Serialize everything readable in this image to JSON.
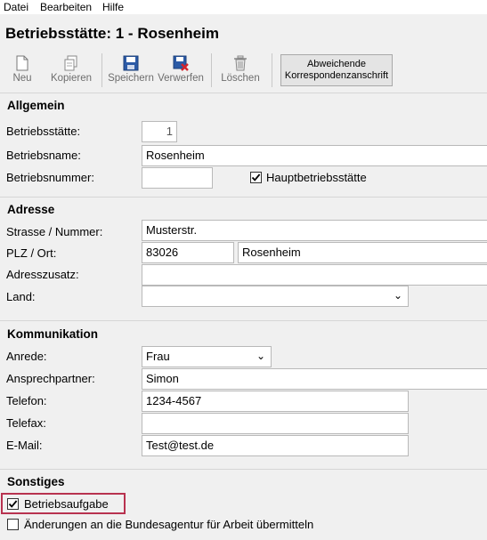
{
  "menu": {
    "file": "Datei",
    "edit": "Bearbeiten",
    "help": "Hilfe"
  },
  "page": {
    "title": "Betriebsstätte: 1 - Rosenheim"
  },
  "toolbar": {
    "new": "Neu",
    "copy": "Kopieren",
    "save": "Speichern",
    "discard": "Verwerfen",
    "delete": "Löschen",
    "alt_address_line1": "Abweichende",
    "alt_address_line2": "Korrespondenzanschrift"
  },
  "general": {
    "heading": "Allgemein",
    "site_label": "Betriebsstätte:",
    "site_value": "1",
    "name_label": "Betriebsname:",
    "name_value": "Rosenheim",
    "number_label": "Betriebsnummer:",
    "number_value": "",
    "main_site_label": "Hauptbetriebsstätte",
    "main_site_checked": true
  },
  "address": {
    "heading": "Adresse",
    "street_label": "Strasse / Nummer:",
    "street_value": "Musterstr.",
    "zip_city_label": "PLZ / Ort:",
    "zip_value": "83026",
    "city_value": "Rosenheim",
    "addition_label": "Adresszusatz:",
    "addition_value": "",
    "country_label": "Land:",
    "country_value": ""
  },
  "communication": {
    "heading": "Kommunikation",
    "salutation_label": "Anrede:",
    "salutation_value": "Frau",
    "contact_label": "Ansprechpartner:",
    "contact_value": "Simon",
    "phone_label": "Telefon:",
    "phone_value": "1234-4567",
    "fax_label": "Telefax:",
    "fax_value": "",
    "email_label": "E-Mail:",
    "email_value": "Test@test.de"
  },
  "misc": {
    "heading": "Sonstiges",
    "closure_label": "Betriebsaufgabe",
    "closure_checked": true,
    "report_label": "Änderungen an die Bundesagentur für Arbeit übermitteln",
    "report_checked": false
  },
  "colors": {
    "highlight": "#b8324f"
  }
}
